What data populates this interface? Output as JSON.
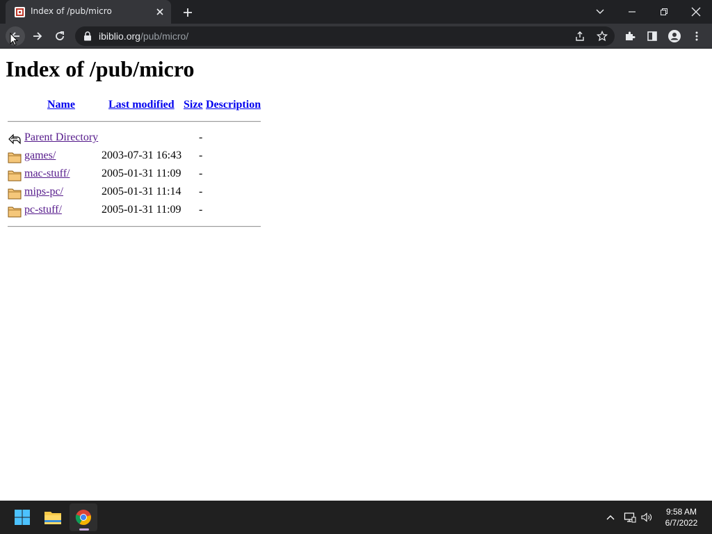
{
  "browser": {
    "tab": {
      "title": "Index of /pub/micro"
    },
    "address": {
      "host": "ibiblio.org",
      "path": "/pub/micro/"
    }
  },
  "page": {
    "heading": "Index of /pub/micro",
    "columns": {
      "name": "Name",
      "last_modified": "Last modified",
      "size": "Size",
      "description": "Description"
    },
    "parent": {
      "name": "Parent Directory",
      "size": "-"
    },
    "entries": [
      {
        "name": "games/",
        "modified": "2003-07-31 16:43",
        "size": "-"
      },
      {
        "name": "mac-stuff/",
        "modified": "2005-01-31 11:09",
        "size": "-"
      },
      {
        "name": "mips-pc/",
        "modified": "2005-01-31 11:14",
        "size": "-"
      },
      {
        "name": "pc-stuff/",
        "modified": "2005-01-31 11:09",
        "size": "-"
      }
    ]
  },
  "taskbar": {
    "clock": {
      "time": "9:58 AM",
      "date": "6/7/2022"
    },
    "apps": [
      "start-icon",
      "file-explorer-icon",
      "chrome-icon"
    ]
  },
  "colors": {
    "link": "#0000ee",
    "visited": "#551a8b",
    "chrome_dark": "#202124",
    "tab_active": "#35363a",
    "taskbar": "#202020"
  }
}
